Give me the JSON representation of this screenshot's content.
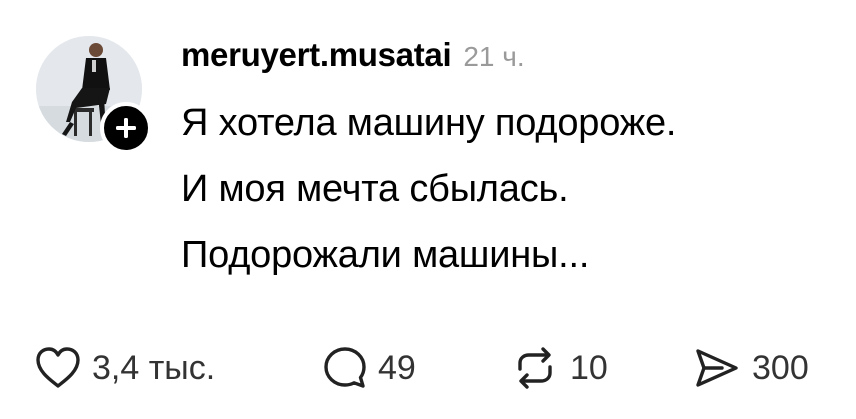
{
  "post": {
    "username": "meruyert.musatai",
    "timestamp": "21 ч.",
    "lines": [
      "Я хотела машину подороже.",
      "И моя мечта сбылась.",
      "Подорожали машины..."
    ]
  },
  "avatar": {
    "icon": "profile-photo",
    "follow_icon": "plus-icon"
  },
  "actions": {
    "like": {
      "icon": "heart-icon",
      "count": "3,4 тыс."
    },
    "comment": {
      "icon": "comment-bubble-icon",
      "count": "49"
    },
    "repost": {
      "icon": "repost-icon",
      "count": "10"
    },
    "share": {
      "icon": "send-icon",
      "count": "300"
    }
  },
  "colors": {
    "text": "#000000",
    "muted": "#9a9a9a",
    "counts": "#333333",
    "background": "#ffffff"
  }
}
